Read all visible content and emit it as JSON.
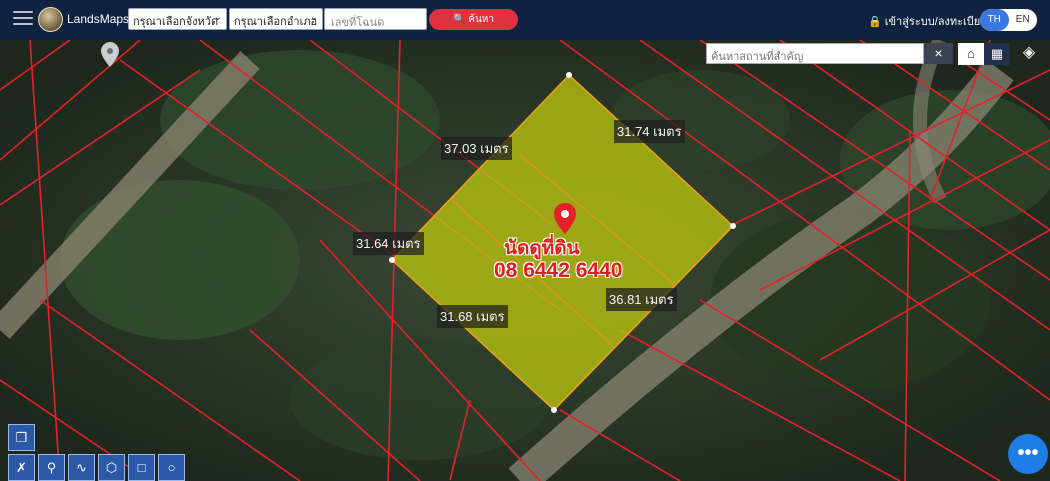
{
  "header": {
    "brand": "LandsMaps",
    "province_select": "กรุณาเลือกจังหวัด",
    "district_select": "กรุณาเลือกอำเภอ",
    "plot_placeholder": "เลขที่โฉนด",
    "search_label": "ค้นหา",
    "login_label": "เข้าสู่ระบบ/ลงทะเบียน",
    "lang_th": "TH",
    "lang_en": "EN"
  },
  "map": {
    "place_search_placeholder": "ค้นหาสถานที่สำคัญ",
    "clear_label": "×",
    "distances": [
      "37.03 เมตร",
      "31.74 เมตร",
      "31.64 เมตร",
      "36.81 เมตร",
      "31.68 เมตร"
    ],
    "ad_line1": "นัดดูที่ดิน",
    "ad_line2": "08 6442 6440",
    "colors": {
      "parcel_fill": "#b9c40e",
      "boundary": "#e5202a",
      "pin": "#e5202a"
    }
  },
  "toolbar": {
    "icons": [
      "eraser-icon",
      "ruler-icon",
      "marker-icon",
      "polyline-icon",
      "polygon-icon",
      "rectangle-icon",
      "circle-icon"
    ]
  },
  "fab": {
    "label": "•••"
  }
}
